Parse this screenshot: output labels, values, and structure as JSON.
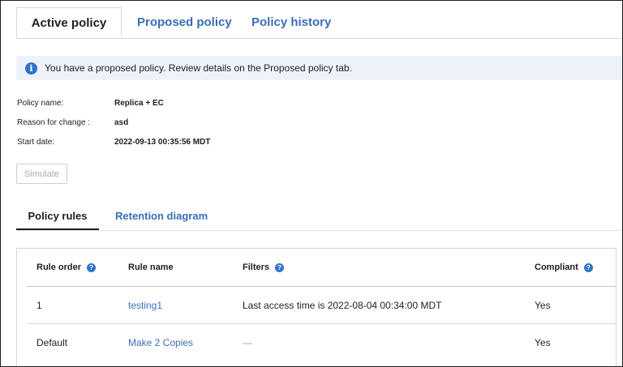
{
  "tabs": [
    {
      "label": "Active policy",
      "active": true
    },
    {
      "label": "Proposed policy",
      "active": false
    },
    {
      "label": "Policy history",
      "active": false
    }
  ],
  "banner": {
    "icon": "info-icon",
    "text": "You have a proposed policy. Review details on the Proposed policy tab."
  },
  "details": [
    {
      "label": "Policy name:",
      "value": "Replica + EC"
    },
    {
      "label": "Reason for change :",
      "value": "asd"
    },
    {
      "label": "Start date:",
      "value": "2022-09-13 00:35:56 MDT"
    }
  ],
  "simulate_label": "Simulate",
  "subtabs": [
    {
      "label": "Policy rules",
      "active": true
    },
    {
      "label": "Retention diagram",
      "active": false
    }
  ],
  "table": {
    "headers": [
      "Rule order",
      "Rule name",
      "Filters",
      "Compliant"
    ],
    "rows": [
      {
        "order": "1",
        "name": "testing1",
        "filters": "Last access time is 2022-08-04 00:34:00 MDT",
        "compliant": "Yes"
      },
      {
        "order": "Default",
        "name": "Make 2 Copies",
        "filters": "—",
        "compliant": "Yes"
      }
    ]
  },
  "colors": {
    "accent": "#3a6eb7",
    "info": "#2f74c9",
    "banner_bg": "#eef3fb"
  }
}
